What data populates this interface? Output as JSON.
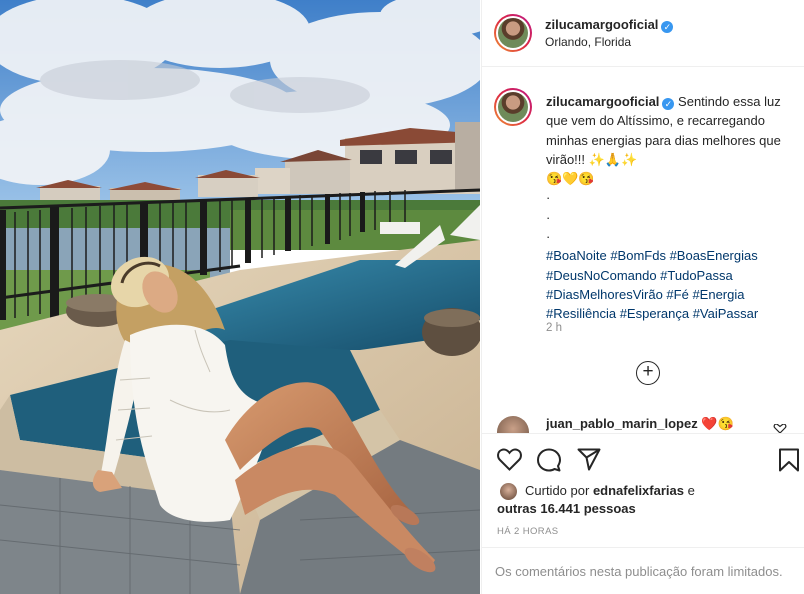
{
  "post": {
    "username": "zilucamargooficial",
    "location": "Orlando, Florida",
    "verified_mark": "✓",
    "caption_line1": "Sentindo essa",
    "caption_rest": "luz que vem do Altíssimo, e recarregando minhas energias para dias melhores que virão!!! ✨🙏✨",
    "caption_emojis": "😘💛😘",
    "dots": [
      "·",
      "·",
      "·"
    ],
    "hashtags": "#BoaNoite #BomFds #BoasEnergias #DeusNoComando #TudoPassa #DiasMelhoresVirão #Fé #Energia #Resiliência #Esperança #VaiPassar",
    "time_ago": "2 h",
    "load_more": "+"
  },
  "comment": {
    "username": "juan_pablo_marin_lopez",
    "text": "❤️😘"
  },
  "actions": {
    "like_icon": "heart-outline-icon",
    "comment_icon": "comment-icon",
    "share_icon": "paper-plane-icon",
    "save_icon": "bookmark-icon"
  },
  "likes": {
    "prefix": "Curtido por",
    "user": "ednafelixfarias",
    "connector": "e",
    "others": "outras 16.441 pessoas"
  },
  "timestamp": "HÁ 2 HORAS",
  "comments_limited": "Os comentários nesta publicação foram limitados.",
  "colors": {
    "link": "#00376b",
    "muted": "#8e8e8e",
    "verified": "#3897f0",
    "like_red": "#ed4956"
  }
}
